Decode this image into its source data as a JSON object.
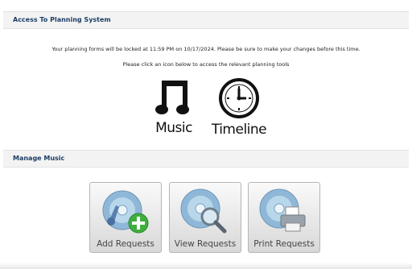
{
  "access_section": {
    "title": "Access To Planning System",
    "notice_lock": "Your planning forms will be locked at 11:59 PM on 10/17/2024. Please be sure to make your changes before this time.",
    "notice_click": "Please click an icon below to access the relevant planning tools",
    "tools": [
      {
        "label": "Music",
        "icon": "music-note-icon"
      },
      {
        "label": "Timeline",
        "icon": "clock-icon"
      }
    ]
  },
  "music_section": {
    "title": "Manage Music",
    "buttons": [
      {
        "label": "Add Requests",
        "icon": "cd-add-icon"
      },
      {
        "label": "View Requests",
        "icon": "cd-magnifier-icon"
      },
      {
        "label": "Print Requests",
        "icon": "cd-printer-icon"
      }
    ]
  },
  "colors": {
    "header_text": "#1c3f66",
    "header_bg": "#f3f3f3",
    "add_accent": "#3fae3f"
  }
}
